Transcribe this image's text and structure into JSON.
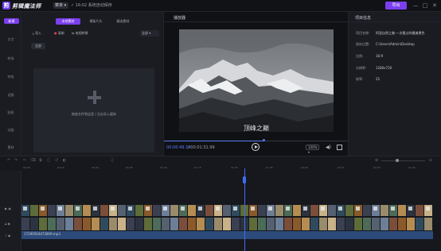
{
  "app": {
    "logo_glyph": "剪",
    "name": "剪辑魔法师",
    "menu_label": "菜单",
    "save_status": "✓ 16:02 系统自动保存",
    "export_label": "导出",
    "window_controls": [
      "—",
      "□",
      "✕"
    ]
  },
  "sidebar": {
    "new_button": "新建",
    "items": [
      "文字",
      "转场",
      "特效",
      "滤镜",
      "贴纸",
      "动画",
      "素材"
    ]
  },
  "media_panel": {
    "tabs": [
      "本地素材",
      "模板片头",
      "精选素材"
    ],
    "toolbar": {
      "import": "导入",
      "record": "录制",
      "change_scene": "电视转换",
      "sort": "全部"
    },
    "filter_all": "全部",
    "dropzone_text": "拖放文件到这里 / 点击导入媒体"
  },
  "player": {
    "title": "播放器",
    "subtitle": "顶峰之巅",
    "time_current": "00:00:49.34",
    "time_total": "/ 00:01:31.99",
    "zoom": "100%",
    "progress": 0.54
  },
  "properties": {
    "title": "项目信息",
    "rows": [
      {
        "key": "项目名称:",
        "value": "阿里自然之美-一次看过的最美景色"
      },
      {
        "key": "保存位置:",
        "value": "C:\\Users\\Admin\\Desktop"
      },
      {
        "key": "比例:",
        "value": "16:9"
      },
      {
        "key": "分辨率:",
        "value": "1280x720"
      },
      {
        "key": "帧率:",
        "value": "25"
      }
    ]
  },
  "timeline": {
    "ruler_labels": [
      "00:00",
      "00:15",
      "00:30",
      "00:45",
      "01:00",
      "01:15",
      "01:30",
      "01:45",
      "02:00",
      "02:15",
      "02:30",
      "02:45"
    ],
    "audio_label": "17290564472809.mp3",
    "tools": [
      "↶",
      "↷",
      "✂",
      "⌫",
      "⧉",
      "▢",
      "↺",
      "◐",
      "♫",
      "⊕",
      "⊖"
    ]
  },
  "colors": {
    "accent": "#7b3ff0",
    "playhead": "#3f6cf5",
    "bg": "#16171c"
  }
}
